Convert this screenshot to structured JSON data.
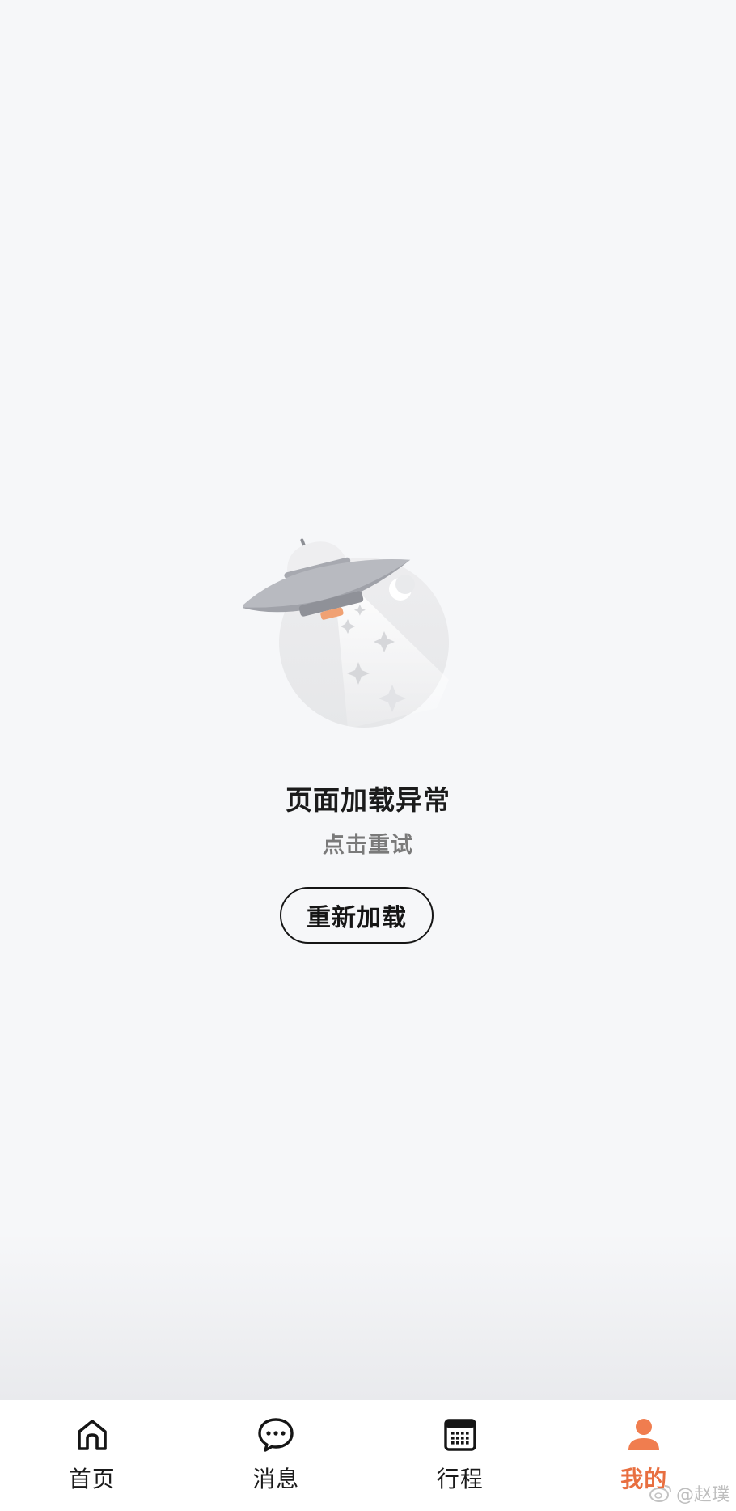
{
  "error": {
    "title": "页面加载异常",
    "subtitle": "点击重试",
    "reload_button": "重新加载"
  },
  "illustration": {
    "icon": "ufo-illustration"
  },
  "tabbar": {
    "tabs": [
      {
        "label": "首页",
        "icon": "home-icon",
        "active": false
      },
      {
        "label": "消息",
        "icon": "chat-bubble-icon",
        "active": false
      },
      {
        "label": "行程",
        "icon": "calendar-icon",
        "active": false
      },
      {
        "label": "我的",
        "icon": "user-icon",
        "active": true
      }
    ],
    "active_color": "#e86f40"
  },
  "watermark": {
    "text": "@赵璞"
  }
}
